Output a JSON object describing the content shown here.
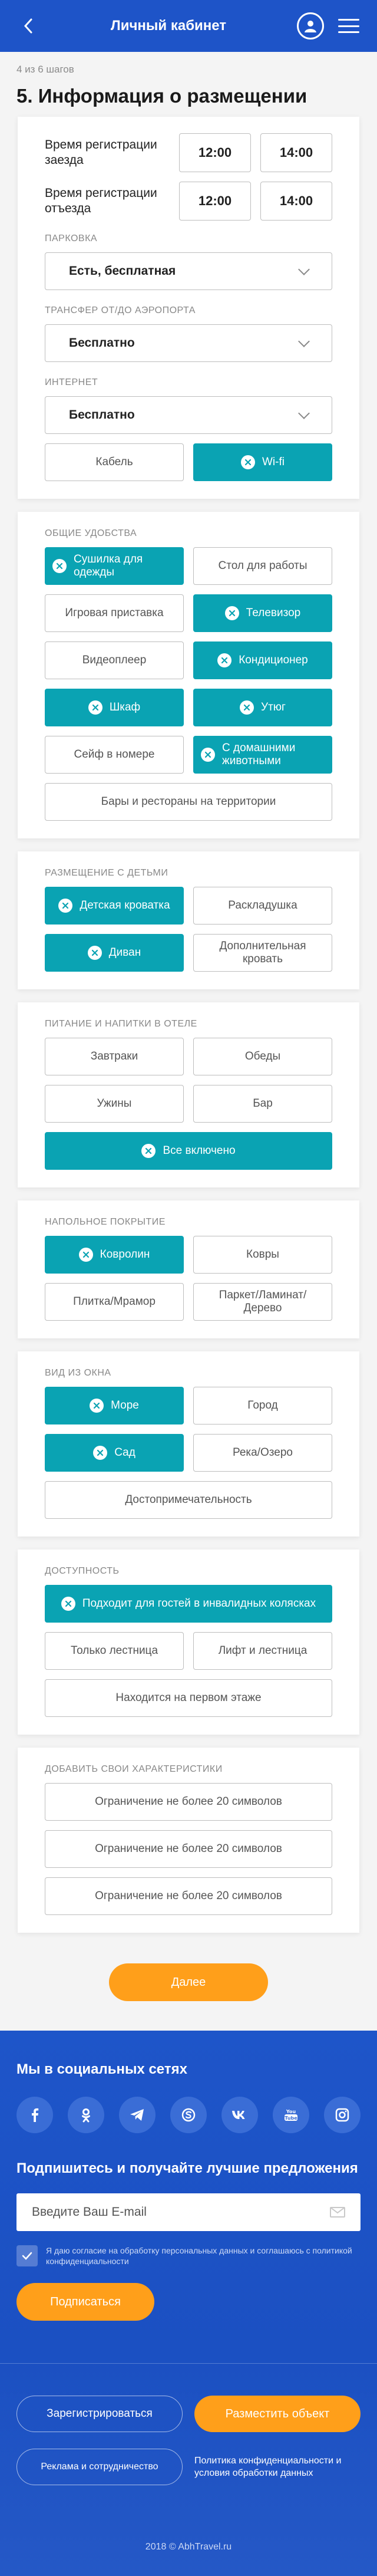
{
  "header": {
    "title": "Личный кабинет"
  },
  "steps": "4 из 6 шагов",
  "page_title": "5. Информация о размещении",
  "registration": {
    "checkin_label": "Время регистрации заезда",
    "checkin_from": "12:00",
    "checkin_to": "14:00",
    "checkout_label": "Время регистрации отъезда",
    "checkout_from": "12:00",
    "checkout_to": "14:00"
  },
  "parking": {
    "label": "ПАРКОВКА",
    "value": "Есть, бесплатная"
  },
  "transfer": {
    "label": "ТРАНСФЕР ОТ/ДО АЭРОПОРТА",
    "value": "Бесплатно"
  },
  "internet": {
    "label": "ИНТЕРНЕТ",
    "value": "Бесплатно",
    "options": [
      {
        "label": "Кабель",
        "selected": false
      },
      {
        "label": "Wi-fi",
        "selected": true
      }
    ]
  },
  "amenities": {
    "label": "ОБЩИЕ УДОБСТВА",
    "options": [
      {
        "label": "Сушилка для одежды",
        "selected": true
      },
      {
        "label": "Стол для работы",
        "selected": false
      },
      {
        "label": "Игровая приставка",
        "selected": false
      },
      {
        "label": "Телевизор",
        "selected": true
      },
      {
        "label": "Видеоплеер",
        "selected": false
      },
      {
        "label": "Кондиционер",
        "selected": true
      },
      {
        "label": "Шкаф",
        "selected": true
      },
      {
        "label": "Утюг",
        "selected": true
      },
      {
        "label": "Сейф в номере",
        "selected": false
      },
      {
        "label": "С домашними животными",
        "selected": true
      },
      {
        "label": "Бары и рестораны на территории",
        "selected": false
      }
    ]
  },
  "children": {
    "label": "РАЗМЕЩЕНИЕ С ДЕТЬМИ",
    "options": [
      {
        "label": "Детская кроватка",
        "selected": true
      },
      {
        "label": "Раскладушка",
        "selected": false
      },
      {
        "label": "Диван",
        "selected": true
      },
      {
        "label": "Дополнительная кровать",
        "selected": false
      }
    ]
  },
  "food": {
    "label": "ПИТАНИЕ И НАПИТКИ В ОТЕЛЕ",
    "options": [
      {
        "label": "Завтраки",
        "selected": false
      },
      {
        "label": "Обеды",
        "selected": false
      },
      {
        "label": "Ужины",
        "selected": false
      },
      {
        "label": "Бар",
        "selected": false
      },
      {
        "label": "Все включено",
        "selected": true
      }
    ]
  },
  "floor": {
    "label": "НАПОЛЬНОЕ ПОКРЫТИЕ",
    "options": [
      {
        "label": "Ковролин",
        "selected": true
      },
      {
        "label": "Ковры",
        "selected": false
      },
      {
        "label": "Плитка/Мрамор",
        "selected": false
      },
      {
        "label": "Паркет/Ламинат/ Дерево",
        "selected": false
      }
    ]
  },
  "view": {
    "label": "ВИД ИЗ ОКНА",
    "options": [
      {
        "label": "Море",
        "selected": true
      },
      {
        "label": "Город",
        "selected": false
      },
      {
        "label": "Сад",
        "selected": true
      },
      {
        "label": "Река/Озеро",
        "selected": false
      },
      {
        "label": "Достопримечательность",
        "selected": false
      }
    ]
  },
  "accessibility": {
    "label": "ДОСТУПНОСТЬ",
    "options": [
      {
        "label": "Подходит для гостей в инвалидных колясках",
        "selected": true
      },
      {
        "label": "Только лестница",
        "selected": false
      },
      {
        "label": "Лифт и лестница",
        "selected": false
      },
      {
        "label": "Находится на первом этаже",
        "selected": false
      }
    ]
  },
  "custom": {
    "label": "ДОБАВИТЬ СВОИ ХАРАКТЕРИСТИКИ",
    "placeholders": [
      "Ограничение не более 20 символов",
      "Ограничение не более 20 символов",
      "Ограничение не более 20 символов"
    ]
  },
  "next_label": "Далее",
  "footer": {
    "social_title": "Мы в социальных сетях",
    "socials": [
      "facebook-icon",
      "odnoklassniki-icon",
      "telegram-icon",
      "skype-icon",
      "vk-icon",
      "youtube-icon",
      "instagram-icon"
    ],
    "subscribe_title": "Подпишитесь и получайте лучшие предложения",
    "email_placeholder": "Введите Ваш E-mail",
    "consent": "Я даю согласие на обработку персональных данных и соглашаюсь с политикой конфиденциальности",
    "subscribe_label": "Подписаться",
    "register_label": "Зарегистрироваться",
    "place_label": "Разместить объект",
    "ads_label": "Реклама и сотрудничество",
    "policy_label": "Политика конфиденциальности и условия обработки данных",
    "copyright": "2018 © AbhTravel.ru"
  },
  "colors": {
    "header": "#1e54c8",
    "accent": "#0aa3b3",
    "button": "#ff9f1a"
  }
}
